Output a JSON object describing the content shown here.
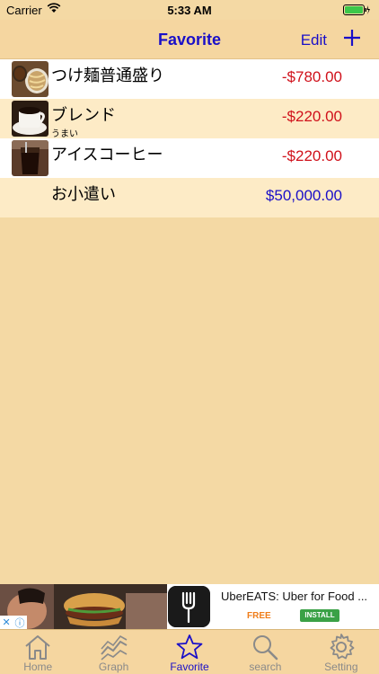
{
  "status_bar": {
    "carrier": "Carrier",
    "time": "5:33 AM"
  },
  "nav": {
    "title": "Favorite",
    "edit_label": "Edit",
    "add_icon": "plus-icon"
  },
  "favorites": [
    {
      "name": "つけ麺普通盛り",
      "memo": "",
      "amount": "-$780.00",
      "type": "expense",
      "thumb": "noodle"
    },
    {
      "name": "ブレンド",
      "memo": "うまい",
      "amount": "-$220.00",
      "type": "expense",
      "thumb": "coffee"
    },
    {
      "name": "アイスコーヒー",
      "memo": "",
      "amount": "-$220.00",
      "type": "expense",
      "thumb": "iced-coffee"
    },
    {
      "name": "お小遣い",
      "memo": "",
      "amount": "$50,000.00",
      "type": "income",
      "thumb": ""
    }
  ],
  "ad": {
    "title": "UberEATS: Uber for Food ...",
    "price": "FREE",
    "install_label": "INSTALL"
  },
  "tabs": [
    {
      "label": "Home",
      "icon": "home-icon",
      "active": false
    },
    {
      "label": "Graph",
      "icon": "graph-icon",
      "active": false
    },
    {
      "label": "Favorite",
      "icon": "star-icon",
      "active": true
    },
    {
      "label": "search",
      "icon": "search-icon",
      "active": false
    },
    {
      "label": "Setting",
      "icon": "gear-icon",
      "active": false
    }
  ],
  "colors": {
    "accent": "#1a0fc8",
    "expense": "#d0111b",
    "background": "#f4d9a4"
  }
}
